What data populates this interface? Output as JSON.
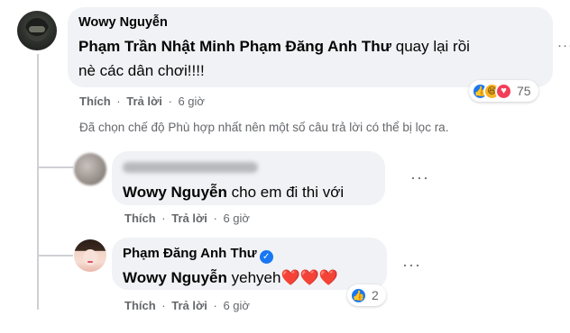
{
  "main_comment": {
    "author": "Wowy Nguyễn",
    "tags": [
      "Phạm Trần Nhật Minh",
      "Phạm Đăng Anh Thư"
    ],
    "text_line1_suffix": "quay lại rồi",
    "text_line2": "nè các dân chơi!!!!",
    "actions": {
      "like": "Thích",
      "reply": "Trả lời",
      "time": "6 giờ"
    },
    "reactions": {
      "icons": [
        "like-icon",
        "haha-icon",
        "love-icon"
      ],
      "count": "75"
    }
  },
  "filter_notice": "Đã chọn chế độ Phù hợp nhất nên một số câu trả lời có thể bị lọc ra.",
  "reply1": {
    "mention": "Wowy Nguyễn",
    "text": "cho em đi thi với",
    "actions": {
      "like": "Thích",
      "reply": "Trả lời",
      "time": "6 giờ"
    }
  },
  "reply2": {
    "author": "Phạm Đăng Anh Thư",
    "mention": "Wowy Nguyễn",
    "text": "yehyeh",
    "actions": {
      "like": "Thích",
      "reply": "Trả lời",
      "time": "6 giờ"
    },
    "reactions": {
      "icons": [
        "like-icon"
      ],
      "count": "2"
    }
  },
  "more_glyph": "···",
  "colors": {
    "bubble": "#f0f2f5",
    "secondary_text": "#65676b",
    "like_blue": "#1877f2",
    "love_red": "#f33e58",
    "haha_yellow": "#f7b125",
    "heart_red": "#e0323b"
  }
}
